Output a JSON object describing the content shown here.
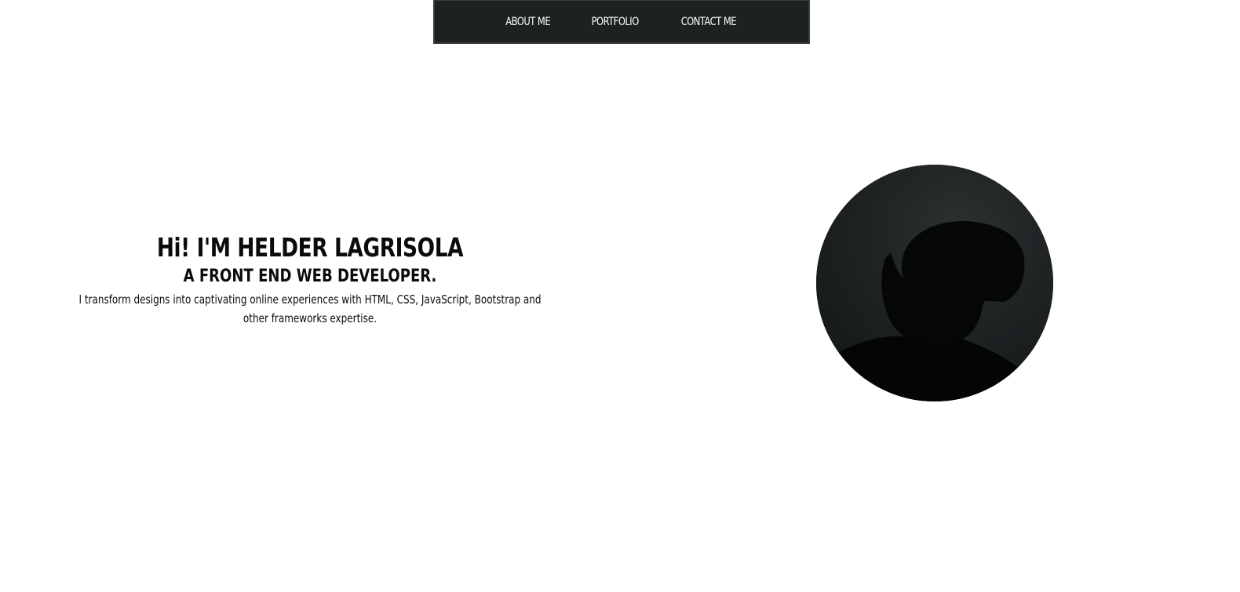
{
  "nav": {
    "items": [
      {
        "label": "ABOUT ME"
      },
      {
        "label": "PORTFOLIO"
      },
      {
        "label": "CONTACT ME"
      }
    ]
  },
  "hero": {
    "title": "Hi! I'M HELDER LAGRISOLA",
    "subtitle": "A FRONT END WEB DEVELOPER.",
    "description": "I transform designs into captivating online experiences with HTML, CSS, JavaScript, Bootstrap and other frameworks expertise."
  },
  "colors": {
    "navbar_bg": "#1e2122",
    "text": "#0b0b0b",
    "background": "#ffffff"
  }
}
